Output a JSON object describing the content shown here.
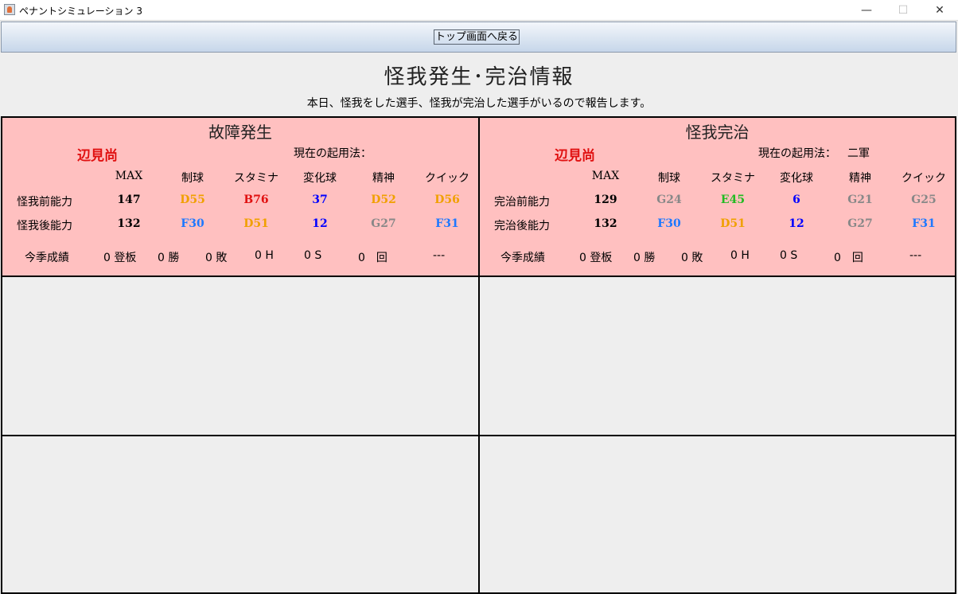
{
  "window": {
    "title": "ペナントシミュレーション 3",
    "min_glyph": "—",
    "max_glyph": "☐",
    "close_glyph": "✕"
  },
  "toolbar": {
    "back_label": "トップ画面へ戻る"
  },
  "header": {
    "title": "怪我発生･完治情報",
    "subtitle": "本日、怪我をした選手、怪我が完治した選手がいるので報告します。"
  },
  "columns": [
    "MAX",
    "制球",
    "スタミナ",
    "変化球",
    "精神",
    "クイック"
  ],
  "panels": [
    {
      "title": "故障発生",
      "player": "辺見尚",
      "usage_label": "現在の起用法：",
      "usage_value": "",
      "rows": [
        {
          "label": "怪我前能力",
          "values": [
            {
              "text": "147",
              "color": "#000000"
            },
            {
              "text": "D55",
              "color": "#f0a000"
            },
            {
              "text": "B76",
              "color": "#e01010"
            },
            {
              "text": "37",
              "color": "#0000ff"
            },
            {
              "text": "D52",
              "color": "#f0a000"
            },
            {
              "text": "D56",
              "color": "#f0a000"
            }
          ]
        },
        {
          "label": "怪我後能力",
          "values": [
            {
              "text": "132",
              "color": "#000000"
            },
            {
              "text": "F30",
              "color": "#1e78ff"
            },
            {
              "text": "D51",
              "color": "#f0a000"
            },
            {
              "text": "12",
              "color": "#0000ff"
            },
            {
              "text": "G27",
              "color": "#888888"
            },
            {
              "text": "F31",
              "color": "#1e78ff"
            }
          ]
        }
      ],
      "season": {
        "label": "今季成績",
        "games": "0 登板",
        "wins": "0 勝",
        "losses": "0 敗",
        "holds": "0 H",
        "saves": "0 S",
        "innings": "0　回",
        "era": "---"
      }
    },
    {
      "title": "怪我完治",
      "player": "辺見尚",
      "usage_label": "現在の起用法：",
      "usage_value": "二軍",
      "rows": [
        {
          "label": "完治前能力",
          "values": [
            {
              "text": "129",
              "color": "#000000"
            },
            {
              "text": "G24",
              "color": "#888888"
            },
            {
              "text": "E45",
              "color": "#22bb22"
            },
            {
              "text": "6",
              "color": "#0000ff"
            },
            {
              "text": "G21",
              "color": "#888888"
            },
            {
              "text": "G25",
              "color": "#888888"
            }
          ]
        },
        {
          "label": "完治後能力",
          "values": [
            {
              "text": "132",
              "color": "#000000"
            },
            {
              "text": "F30",
              "color": "#1e78ff"
            },
            {
              "text": "D51",
              "color": "#f0a000"
            },
            {
              "text": "12",
              "color": "#0000ff"
            },
            {
              "text": "G27",
              "color": "#888888"
            },
            {
              "text": "F31",
              "color": "#1e78ff"
            }
          ]
        }
      ],
      "season": {
        "label": "今季成績",
        "games": "0 登板",
        "wins": "0 勝",
        "losses": "0 敗",
        "holds": "0 H",
        "saves": "0 S",
        "innings": "0　回",
        "era": "---"
      }
    }
  ]
}
